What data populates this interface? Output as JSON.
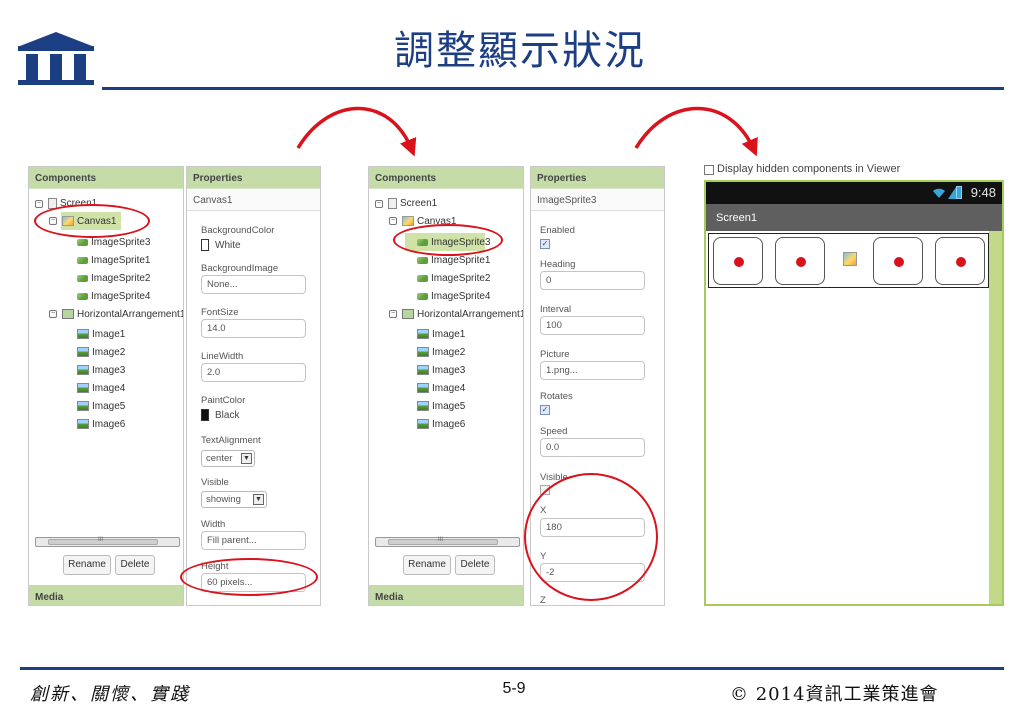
{
  "slide": {
    "title": "調整顯示狀況",
    "footer_left": "創新、關懷、實踐",
    "page_number": "5-9",
    "footer_right": "© 2014資訊工業策進會"
  },
  "colors": {
    "title_blue": "#1c3f84",
    "panel_header_green": "#c6dca8",
    "highlight_red": "#d9121b",
    "viewer_border": "#a6cc5b"
  },
  "icons": {
    "logo": "roman-temple-columns-logo",
    "arrows": "curved-red-arrow",
    "screen": "screen-icon",
    "canvas": "canvas-icon",
    "sprite": "image-sprite-icon",
    "image": "image-icon",
    "arrangement": "horizontal-arrangement-icon",
    "wifi": "wifi-icon",
    "signal": "signal-icon",
    "battery": "battery-icon"
  },
  "left_components": {
    "header": "Components",
    "tree": [
      {
        "label": "Screen1"
      },
      {
        "label": "Canvas1"
      },
      {
        "label": "ImageSprite3"
      },
      {
        "label": "ImageSprite1"
      },
      {
        "label": "ImageSprite2"
      },
      {
        "label": "ImageSprite4"
      },
      {
        "label": "HorizontalArrangement1"
      },
      {
        "label": "Image1"
      },
      {
        "label": "Image2"
      },
      {
        "label": "Image3"
      },
      {
        "label": "Image4"
      },
      {
        "label": "Image5"
      },
      {
        "label": "Image6"
      }
    ],
    "scroll_mark": "III",
    "rename": "Rename",
    "delete": "Delete",
    "media": "Media"
  },
  "left_properties": {
    "header": "Properties",
    "component_name": "Canvas1",
    "background_color_label": "BackgroundColor",
    "background_color_value": "White",
    "background_image_label": "BackgroundImage",
    "background_image_value": "None...",
    "font_size_label": "FontSize",
    "font_size_value": "14.0",
    "line_width_label": "LineWidth",
    "line_width_value": "2.0",
    "paint_color_label": "PaintColor",
    "paint_color_value": "Black",
    "text_alignment_label": "TextAlignment",
    "text_alignment_value": "center",
    "visible_label": "Visible",
    "visible_value": "showing",
    "width_label": "Width",
    "width_value": "Fill parent...",
    "height_label": "Height",
    "height_value": "60 pixels..."
  },
  "right_components": {
    "header": "Components",
    "tree": [
      {
        "label": "Screen1"
      },
      {
        "label": "Canvas1"
      },
      {
        "label": "ImageSprite3"
      },
      {
        "label": "ImageSprite1"
      },
      {
        "label": "ImageSprite2"
      },
      {
        "label": "ImageSprite4"
      },
      {
        "label": "HorizontalArrangement1"
      },
      {
        "label": "Image1"
      },
      {
        "label": "Image2"
      },
      {
        "label": "Image3"
      },
      {
        "label": "Image4"
      },
      {
        "label": "Image5"
      },
      {
        "label": "Image6"
      }
    ],
    "scroll_mark": "III",
    "rename": "Rename",
    "delete": "Delete",
    "media": "Media"
  },
  "right_properties": {
    "header": "Properties",
    "component_name": "ImageSprite3",
    "enabled_label": "Enabled",
    "enabled_checked": true,
    "heading_label": "Heading",
    "heading_value": "0",
    "interval_label": "Interval",
    "interval_value": "100",
    "picture_label": "Picture",
    "picture_value": "1.png...",
    "rotates_label": "Rotates",
    "rotates_checked": true,
    "speed_label": "Speed",
    "speed_value": "0.0",
    "visible_label": "Visible",
    "visible_checked": false,
    "x_label": "X",
    "x_value": "180",
    "y_label": "Y",
    "y_value": "-2",
    "z_label": "Z"
  },
  "viewer": {
    "display_hidden_label": "Display hidden components in Viewer",
    "display_hidden_checked": false,
    "status_time": "9:48",
    "screen_title": "Screen1",
    "visible_sprites": 4,
    "hidden_sprites": 1
  }
}
